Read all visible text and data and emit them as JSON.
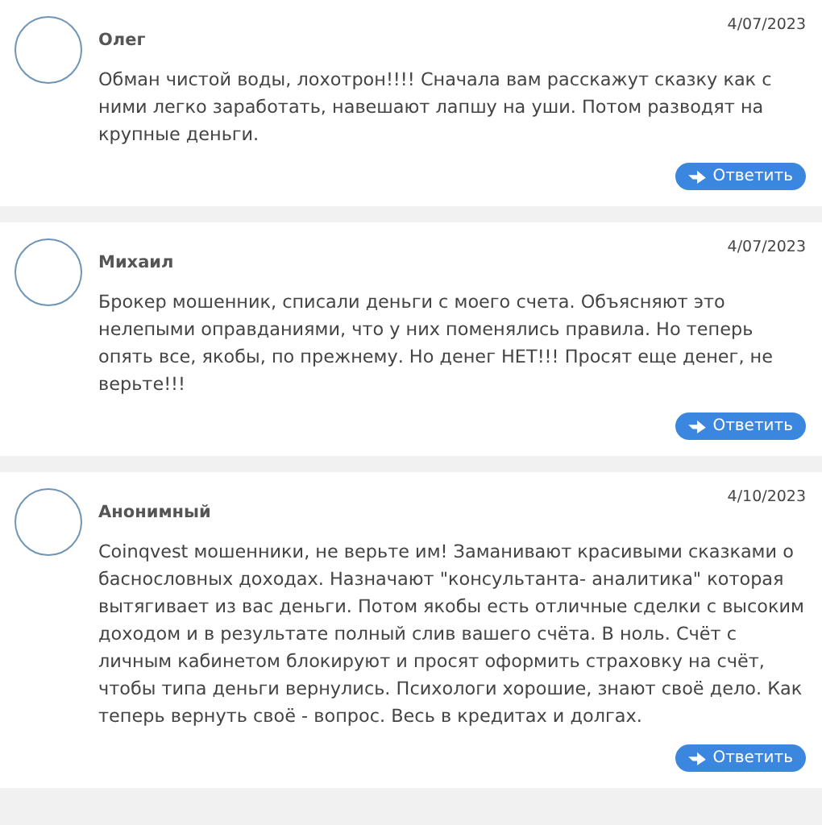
{
  "comments": [
    {
      "author": "Олег",
      "date": "4/07/2023",
      "text": "Обман чистой воды, лохотрон!!!! Сначала вам расскажут сказку как с ними легко заработать, навешают лапшу на уши. Потом разводят на крупные деньги.",
      "reply_button": "Ответить"
    },
    {
      "author": "Михаил",
      "date": "4/07/2023",
      "text": "Брокер мошенник, списали деньги с моего счета. Объясняют это нелепыми оправданиями, что у них поменялись правила. Но теперь опять все, якобы, по прежнему. Но денег НЕТ!!! Просят еще денег, не верьте!!!",
      "reply_button": "Ответить"
    },
    {
      "author": "Анонимный",
      "date": "4/10/2023",
      "text": "Coinqvest мошенники, не верьте им! Заманивают красивыми сказками о баснословных доходах. Назначают \"консультанта- аналитика\" которая вытягивает из вас деньги. Потом якобы есть отличные сделки с высоким доходом и в результате полный слив вашего счёта. В ноль. Счёт с личным кабинетом блокируют и просят оформить страховку на счёт, чтобы типа деньги вернулись. Психологи хорошие, знают своё дело. Как теперь вернуть своё - вопрос. Весь в кредитах и долгах.",
      "reply_button": "Ответить"
    }
  ]
}
